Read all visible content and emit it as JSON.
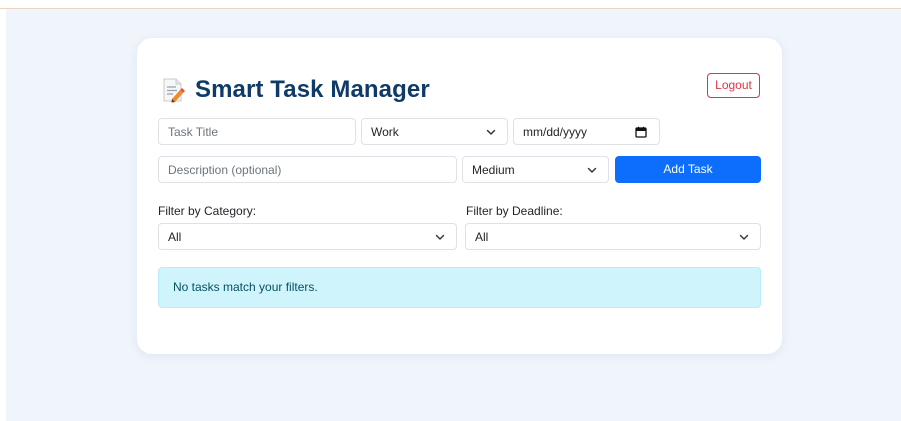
{
  "header": {
    "title": "Smart Task Manager",
    "icon": "memo-icon",
    "logout_label": "Logout"
  },
  "form": {
    "task_title_placeholder": "Task Title",
    "category_value": "Work",
    "deadline_placeholder": "mm/dd/yyyy",
    "description_placeholder": "Description (optional)",
    "priority_value": "Medium",
    "add_button_label": "Add Task"
  },
  "filters": {
    "category_label": "Filter by Category:",
    "category_value": "All",
    "deadline_label": "Filter by Deadline:",
    "deadline_value": "All"
  },
  "tasks": {
    "empty_message": "No tasks match your filters."
  },
  "colors": {
    "title": "#0f3b68",
    "primary": "#0d6efd",
    "danger": "#dc3545",
    "info_bg": "#cff4fc",
    "page_bg": "#f0f4fb"
  }
}
